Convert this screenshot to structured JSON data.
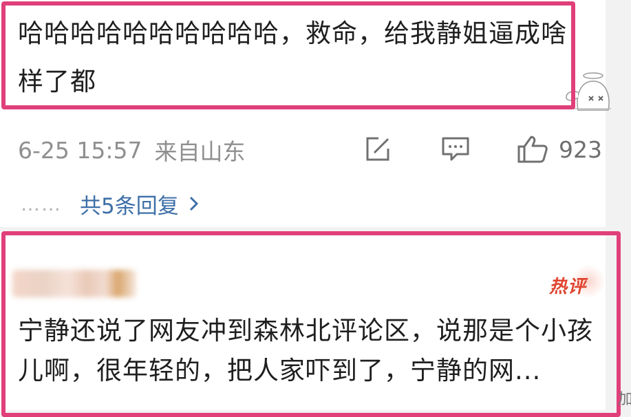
{
  "comment": {
    "text": "哈哈哈哈哈哈哈哈哈哈，救命，给我静姐逼成啥样了都",
    "date": "6-25 15:57",
    "location": "来自山东",
    "like_count": "923",
    "replies_label": "共5条回复",
    "replies_prefix": "……"
  },
  "hot_comment": {
    "badge": "热评",
    "text": "宁静还说了网友冲到森林北评论区，说那是个小孩儿啊，很年轻的，把人家吓到了，宁静的网..."
  },
  "edge_glyph": "加",
  "icons": {
    "edit": "edit-icon",
    "comment": "comment-icon",
    "like": "thumbs-up-icon",
    "chevron": "chevron-right-icon",
    "mascot": "mascot-icon"
  },
  "colors": {
    "highlight": "#e0407a",
    "link": "#3d6fa8",
    "meta": "#8f8f8f",
    "hot": "#e0442e"
  }
}
